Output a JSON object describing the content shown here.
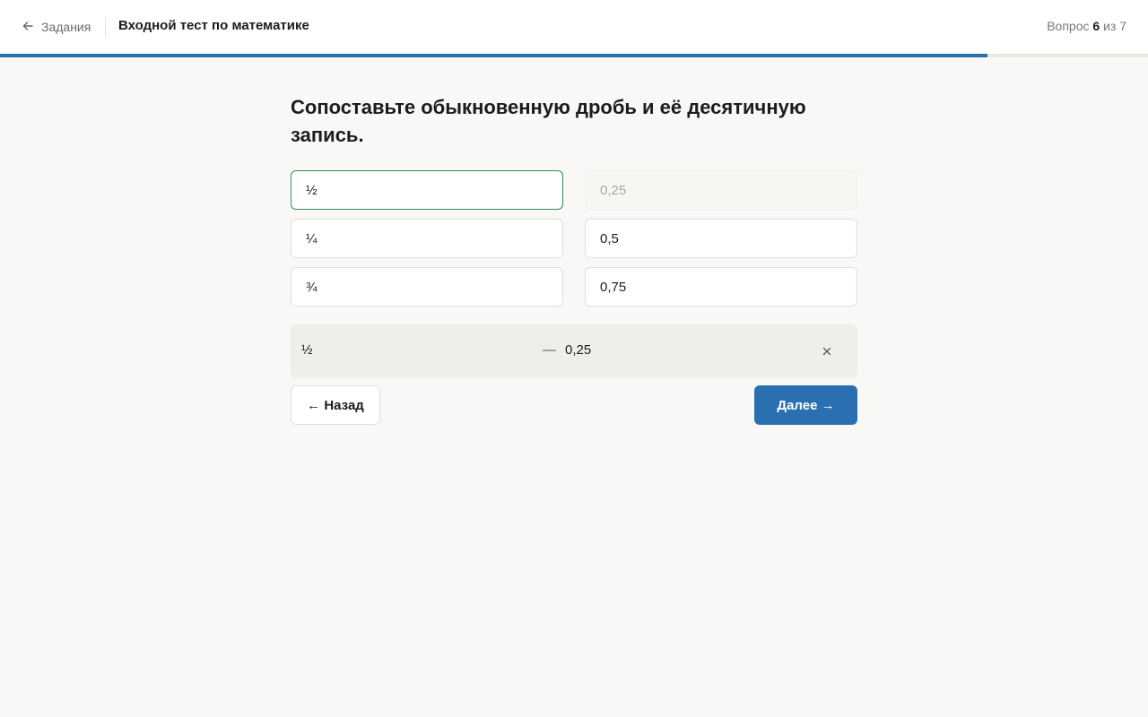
{
  "header": {
    "back_label": "Задания",
    "test_title": "Входной тест по математике",
    "counter_prefix": "Вопрос",
    "counter_current": "6",
    "counter_sep": "из 7"
  },
  "progress": {
    "value": 0.86,
    "color": "#2a6fb0"
  },
  "question": {
    "text": "Сопоставьте обыкновенную дробь и её десятичную запись."
  },
  "left_options": [
    {
      "label": "½",
      "state": "selected"
    },
    {
      "label": "¼",
      "state": "default"
    },
    {
      "label": "¾",
      "state": "default"
    }
  ],
  "right_options": [
    {
      "label": "0,25",
      "state": "used"
    },
    {
      "label": "0,5",
      "state": "default"
    },
    {
      "label": "0,75",
      "state": "default"
    }
  ],
  "pairs": [
    {
      "left": "½",
      "separator": "—",
      "right": "0,25",
      "remove_icon": "close-icon"
    }
  ],
  "nav": {
    "back_label": "← Назад",
    "next_label": "Далее →"
  },
  "colors": {
    "accent": "#2a6fb0",
    "selected_border": "#2e8b57"
  }
}
